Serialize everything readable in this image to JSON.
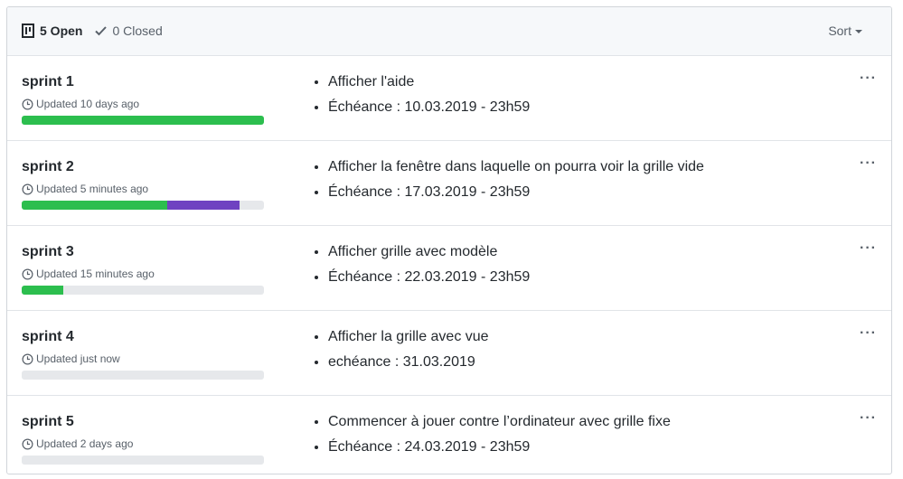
{
  "header": {
    "open_label": "5 Open",
    "closed_label": "0 Closed",
    "sort_label": "Sort"
  },
  "colors": {
    "done": "#2cbe4e",
    "in_progress": "#6f42c1",
    "track": "#e6e8eb"
  },
  "milestones": [
    {
      "title": "sprint 1",
      "updated": "Updated 10 days ago",
      "progress": {
        "done_fraction": 1.0,
        "in_progress_fraction": 0.0
      },
      "items": [
        "Afficher l'aide",
        "Échéance : 10.03.2019 - 23h59"
      ],
      "menu": "···"
    },
    {
      "title": "sprint 2",
      "updated": "Updated 5 minutes ago",
      "progress": {
        "done_fraction": 0.6,
        "in_progress_fraction": 0.3
      },
      "items": [
        "Afficher la fenêtre dans laquelle on pourra voir la grille vide",
        "Échéance : 17.03.2019 - 23h59"
      ],
      "menu": "···"
    },
    {
      "title": "sprint 3",
      "updated": "Updated 15 minutes ago",
      "progress": {
        "done_fraction": 0.17,
        "in_progress_fraction": 0.0
      },
      "items": [
        "Afficher grille avec modèle",
        "Échéance : 22.03.2019 - 23h59"
      ],
      "menu": "···"
    },
    {
      "title": "sprint 4",
      "updated": "Updated just now",
      "progress": {
        "done_fraction": 0.0,
        "in_progress_fraction": 0.0
      },
      "items": [
        "Afficher la grille avec vue",
        "echéance : 31.03.2019"
      ],
      "menu": "···"
    },
    {
      "title": "sprint 5",
      "updated": "Updated 2 days ago",
      "progress": {
        "done_fraction": 0.0,
        "in_progress_fraction": 0.0
      },
      "items": [
        "Commencer à jouer contre l’ordinateur avec grille fixe",
        "Échéance : 24.03.2019 - 23h59"
      ],
      "menu": "···"
    }
  ]
}
